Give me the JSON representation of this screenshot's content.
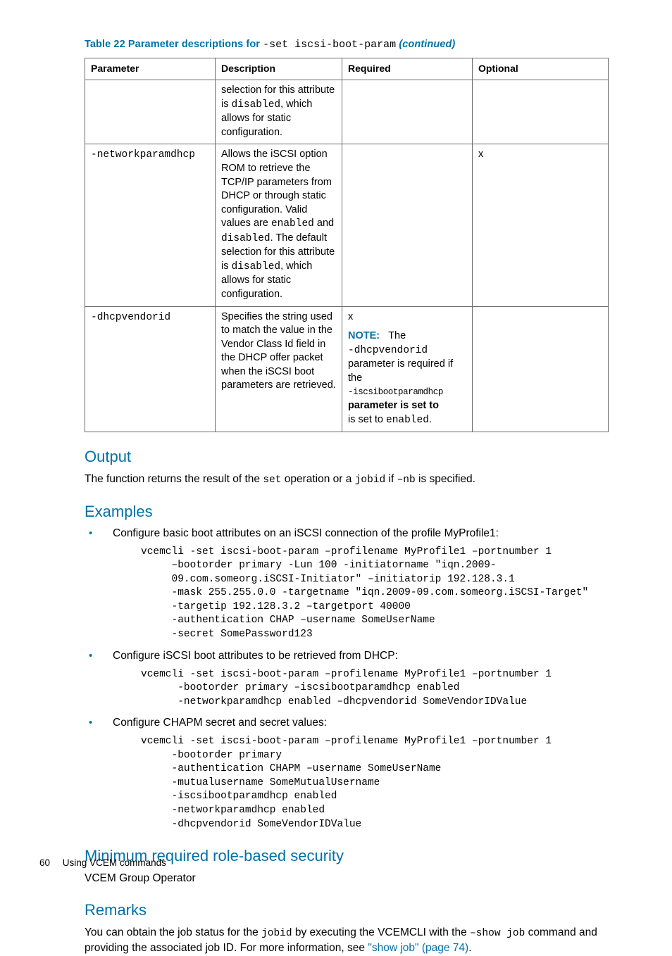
{
  "tableTitle": {
    "prefix": "Table 22 Parameter descriptions for ",
    "code": "-set iscsi-boot-param",
    "suffix": " (continued)"
  },
  "tableHeaders": {
    "parameter": "Parameter",
    "description": "Description",
    "required": "Required",
    "optional": "Optional"
  },
  "rows": {
    "row0": {
      "parameter": "",
      "desc_before": "selection for this attribute is ",
      "desc_code": "disabled",
      "desc_after": ", which allows for static configuration.",
      "required": "",
      "optional": ""
    },
    "row1": {
      "parameter": "-networkparamdhcp",
      "desc_p1": "Allows the iSCSI option ROM to retrieve the TCP/IP parameters from DHCP or through static configuration. Valid values are ",
      "desc_c1": "enabled",
      "desc_p2": " and ",
      "desc_c2": "disabled",
      "desc_p3": ". The default selection for this attribute is ",
      "desc_c3": "disabled",
      "desc_p4": ", which allows for static configuration.",
      "required": "",
      "optional": "x"
    },
    "row2": {
      "parameter": "-dhcpvendorid",
      "desc": "Specifies the string used to match the value in the Vendor Class Id field in the DHCP offer packet when the iSCSI boot parameters are retrieved.",
      "req_x": "x",
      "note_label": "NOTE:",
      "note_t1": "The ",
      "note_c1": "-dhcpvendorid",
      "note_t2": " parameter is required if the ",
      "note_c2": "-iscsibootparamdhcp",
      "note_t3": " parameter is set to ",
      "note_c3": "enabled",
      "note_t4": ".",
      "optional": ""
    }
  },
  "sections": {
    "output": {
      "heading": "Output",
      "body_p1": "The function returns the result of the ",
      "body_c1": "set",
      "body_p2": " operation or a ",
      "body_c2": "jobid",
      "body_p3": " if ",
      "body_c3": "–nb",
      "body_p4": " is specified."
    },
    "examples": {
      "heading": "Examples",
      "item1_text": "Configure basic boot attributes on an iSCSI connection of the profile MyProfile1:",
      "item1_code": "vcemcli -set iscsi-boot-param –profilename MyProfile1 –portnumber 1\n     –bootorder primary -Lun 100 -initiatorname \"iqn.2009-\n     09.com.someorg.iSCSI-Initiator\" –initiatorip 192.128.3.1\n     -mask 255.255.0.0 -targetname \"iqn.2009-09.com.someorg.iSCSI-Target\"\n     -targetip 192.128.3.2 –targetport 40000\n     -authentication CHAP –username SomeUserName\n     -secret SomePassword123",
      "item2_text": "Configure iSCSI boot attributes to be retrieved from DHCP:",
      "item2_code": "vcemcli -set iscsi-boot-param –profilename MyProfile1 –portnumber 1\n      -bootorder primary –iscsibootparamdhcp enabled\n      -networkparamdhcp enabled –dhcpvendorid SomeVendorIDValue",
      "item3_text": "Configure CHAPM secret and secret values:",
      "item3_code": "vcemcli -set iscsi-boot-param –profilename MyProfile1 –portnumber 1\n     -bootorder primary\n     -authentication CHAPM –username SomeUserName\n     -mutualusername SomeMutualUsername\n     -iscsibootparamdhcp enabled\n     -networkparamdhcp enabled\n     -dhcpvendorid SomeVendorIDValue"
    },
    "security": {
      "heading": "Minimum required role-based security",
      "body": "VCEM Group Operator"
    },
    "remarks": {
      "heading": "Remarks",
      "body_p1": "You can obtain the job status for the ",
      "body_c1": "jobid",
      "body_p2": " by executing the VCEMCLI with the ",
      "body_c2": "–show job",
      "body_p3": " command and providing the associated job ID. For more information, see ",
      "link": "\"show job\" (page 74)",
      "body_p4": "."
    }
  },
  "footer": {
    "page": "60",
    "text": "Using VCEM commands"
  }
}
